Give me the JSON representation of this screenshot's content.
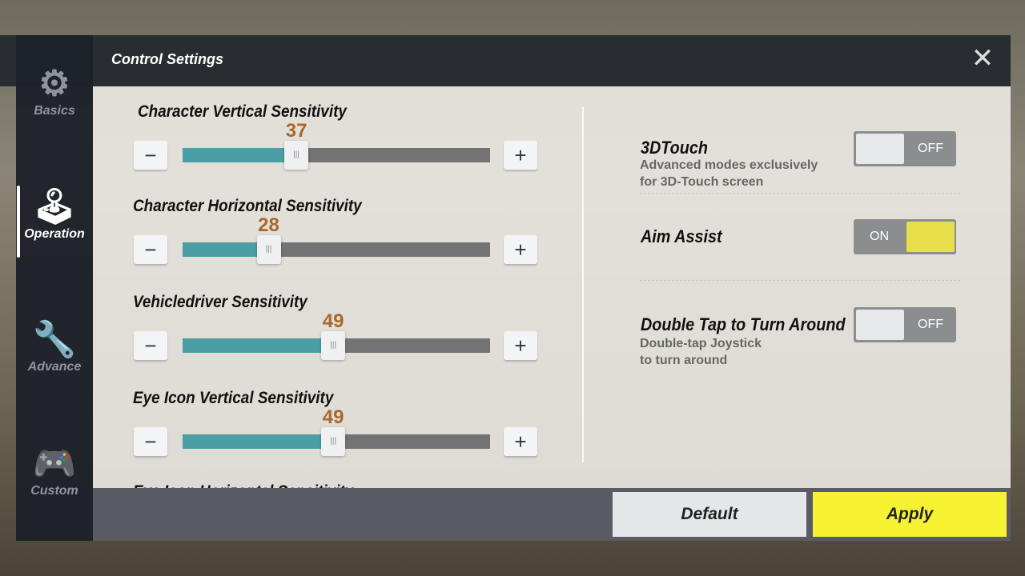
{
  "header": {
    "title": "Control Settings",
    "close_icon": "close-icon"
  },
  "sidebar": {
    "items": [
      {
        "label": "Basics",
        "icon": "gear-icon",
        "active": false
      },
      {
        "label": "Operation",
        "icon": "joystick-gear-icon",
        "active": true
      },
      {
        "label": "Advance",
        "icon": "wrench-gear-icon",
        "active": false
      },
      {
        "label": "Custom",
        "icon": "gamepad-gear-icon",
        "active": false
      }
    ]
  },
  "sliders": {
    "min": 0,
    "max": 100,
    "items": [
      {
        "label": "Character Vertical Sensitivity",
        "value": "37"
      },
      {
        "label": "Character Horizontal Sensitivity",
        "value": "28"
      },
      {
        "label": "Vehicledriver Sensitivity",
        "value": "49"
      },
      {
        "label": "Eye Icon Vertical Sensitivity",
        "value": "49"
      },
      {
        "label": "Eye Icon Horizontal Sensitivity"
      }
    ]
  },
  "toggles": [
    {
      "label": "3DTouch",
      "description_line1": "Advanced modes exclusively",
      "description_line2": "for 3D-Touch screen",
      "state": "OFF"
    },
    {
      "label": "Aim Assist",
      "state": "ON"
    },
    {
      "label": "Double Tap to Turn Around",
      "description_line1": "Double-tap Joystick",
      "description_line2": "to turn around",
      "state": "OFF"
    }
  ],
  "footer": {
    "default_label": "Default",
    "apply_label": "Apply"
  },
  "colors": {
    "accent": "#f3ee2e",
    "slider_fill": "#4a9ea6",
    "value_text": "#a8682c"
  },
  "symbols": {
    "minus": "−",
    "plus": "+",
    "grip": "|||",
    "close": "✕"
  }
}
